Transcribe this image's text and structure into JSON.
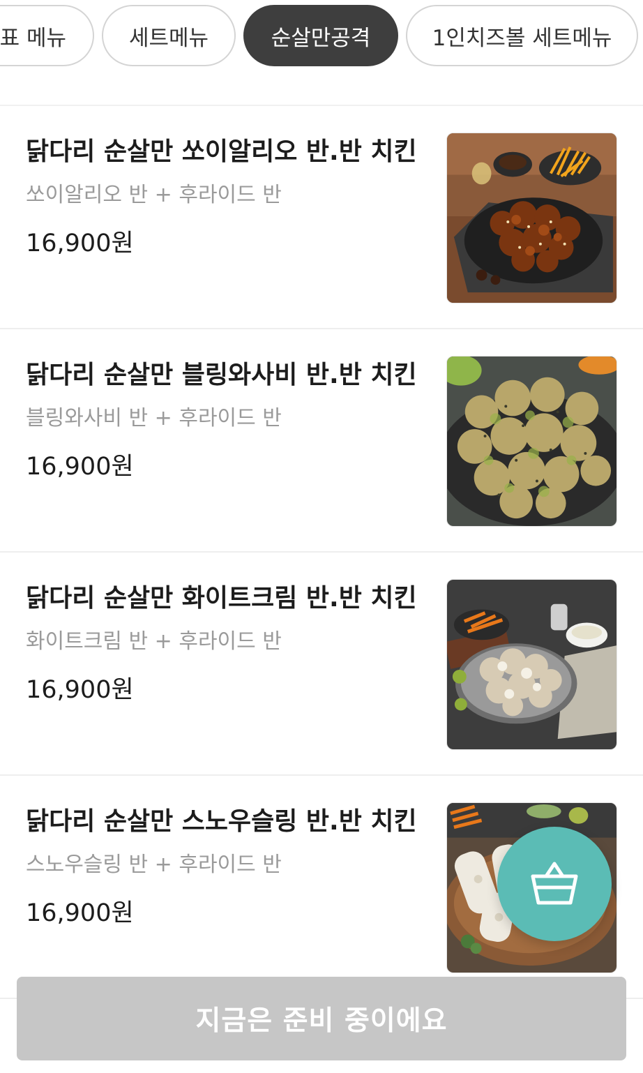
{
  "category_tabs": [
    {
      "label": "대표 메뉴",
      "active": false
    },
    {
      "label": "세트메뉴",
      "active": false
    },
    {
      "label": "순살만공격",
      "active": true
    },
    {
      "label": "1인치즈볼 세트메뉴",
      "active": false
    }
  ],
  "menu_items": [
    {
      "name": "닭다리 순살만 쏘이알리오 반.반 치킨",
      "description": "쏘이알리오 반 + 후라이드 반",
      "price": "16,900원",
      "image": "soy-aglio-chicken-photo"
    },
    {
      "name": "닭다리 순살만 블링와사비 반.반 치킨",
      "description": "블링와사비 반 + 후라이드 반",
      "price": "16,900원",
      "image": "bling-wasabi-chicken-photo"
    },
    {
      "name": "닭다리 순살만 화이트크림 반.반 치킨",
      "description": "화이트크림 반 + 후라이드 반",
      "price": "16,900원",
      "image": "white-cream-chicken-photo"
    },
    {
      "name": "닭다리 순살만 스노우슬링 반.반 치킨",
      "description": "스노우슬링 반 + 후라이드 반",
      "price": "16,900원",
      "image": "snow-sling-chicken-photo"
    }
  ],
  "cart_button": {
    "icon": "shopping-basket-icon",
    "color": "#5bbcb5"
  },
  "order_button": {
    "label": "지금은 준비 중이에요",
    "enabled": false
  },
  "colors": {
    "active_tab": "#3e3e3e",
    "disabled_button": "#c6c6c6",
    "description_text": "#9a9a9a"
  }
}
